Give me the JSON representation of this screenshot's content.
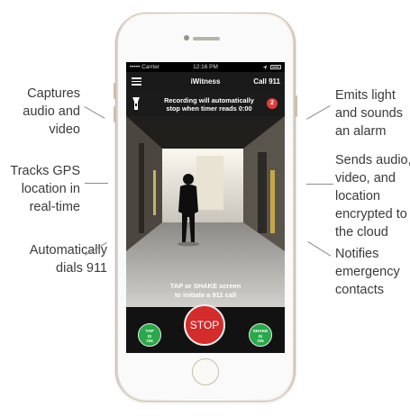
{
  "callouts": {
    "captures": [
      "Captures",
      "audio and",
      "video"
    ],
    "tracks_gps": [
      "Tracks GPS",
      "location in",
      "real-time"
    ],
    "dials": [
      "Automatically",
      "dials 911"
    ],
    "emits": [
      "Emits light",
      "and sounds",
      "an alarm"
    ],
    "sends": [
      "Sends audio,",
      "video, and",
      "location",
      "encrypted to",
      "the cloud"
    ],
    "notifies": [
      "Notifies",
      "emergency",
      "contacts"
    ]
  },
  "status_bar": {
    "carrier": "••••• Carrier",
    "time": "12:16 PM"
  },
  "nav": {
    "title": "iWitness",
    "call_label": "Call 911"
  },
  "alarm": {
    "recording_line1": "Recording will automatically",
    "recording_line2": "stop when timer reads 0:00",
    "timer_value": "2"
  },
  "video": {
    "hint_line1": "TAP or SHAKE screen",
    "hint_line2": "to initiate a 911 call"
  },
  "controls": {
    "tap_toggle": [
      "TAP",
      "IS",
      "ON"
    ],
    "stop_label": "STOP",
    "shake_toggle": [
      "SHAKE",
      "IS",
      "ON"
    ]
  },
  "colors": {
    "stop_red": "#d42b2b",
    "toggle_green": "#2ba84a",
    "badge_red": "#e23b3b"
  }
}
